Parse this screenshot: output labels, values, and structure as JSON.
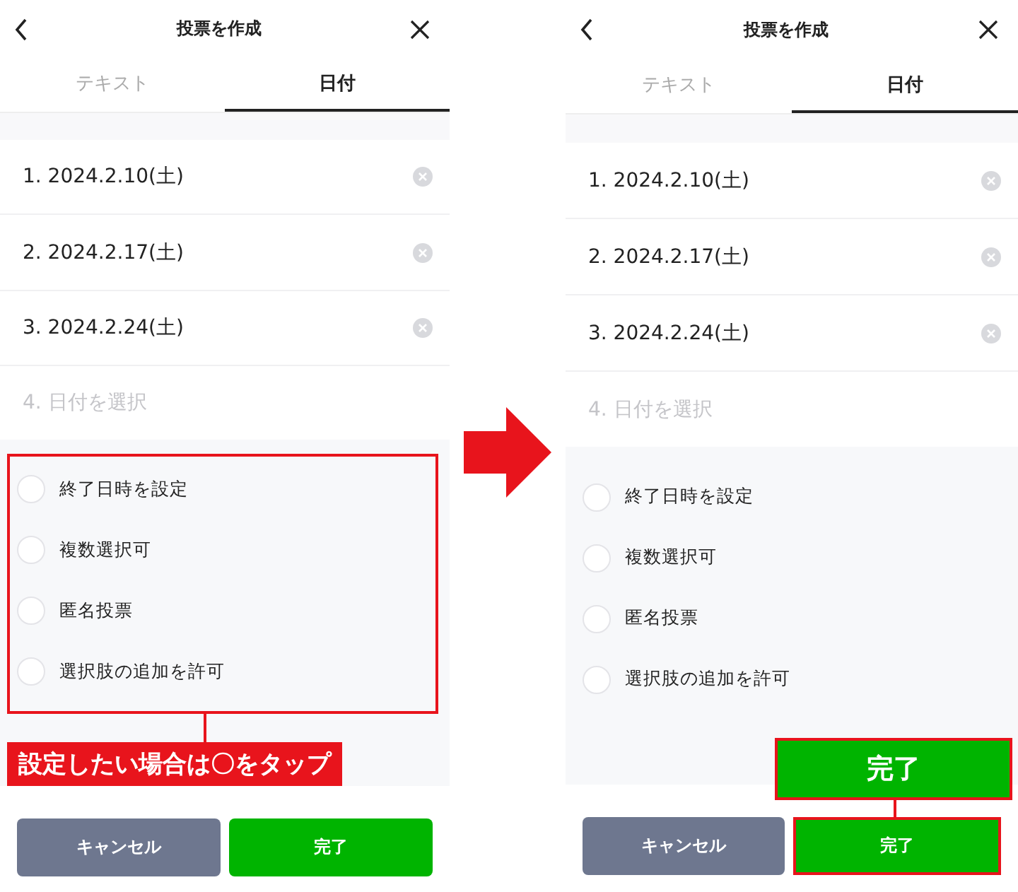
{
  "screens": [
    {
      "title": "投票を作成",
      "tabs": [
        {
          "label": "テキスト",
          "selected": false
        },
        {
          "label": "日付",
          "selected": true
        }
      ],
      "dates": [
        {
          "number": "1.",
          "date": "2024.2.10(土)"
        },
        {
          "number": "2.",
          "date": "2024.2.17(土)"
        },
        {
          "number": "3.",
          "date": "2024.2.24(土)"
        }
      ],
      "placeholder": {
        "number": "4.",
        "text": "日付を選択"
      },
      "options": [
        {
          "label": "終了日時を設定",
          "checked": false
        },
        {
          "label": "複数選択可",
          "checked": false
        },
        {
          "label": "匿名投票",
          "checked": false
        },
        {
          "label": "選択肢の追加を許可",
          "checked": false
        }
      ],
      "buttons": {
        "cancel": "キャンセル",
        "confirm": "完了"
      },
      "annotation": {
        "kind": "outline-options",
        "label": "設定したい場合は〇をタップ"
      }
    },
    {
      "title": "投票を作成",
      "tabs": [
        {
          "label": "テキスト",
          "selected": false
        },
        {
          "label": "日付",
          "selected": true
        }
      ],
      "dates": [
        {
          "number": "1.",
          "date": "2024.2.10(土)"
        },
        {
          "number": "2.",
          "date": "2024.2.17(土)"
        },
        {
          "number": "3.",
          "date": "2024.2.24(土)"
        }
      ],
      "placeholder": {
        "number": "4.",
        "text": "日付を選択"
      },
      "options": [
        {
          "label": "終了日時を設定",
          "checked": false
        },
        {
          "label": "複数選択可",
          "checked": false
        },
        {
          "label": "匿名投票",
          "checked": false
        },
        {
          "label": "選択肢の追加を許可",
          "checked": false
        }
      ],
      "buttons": {
        "cancel": "キャンセル",
        "confirm": "完了"
      },
      "annotation": {
        "kind": "highlight-confirm",
        "label": "完了"
      }
    }
  ]
}
